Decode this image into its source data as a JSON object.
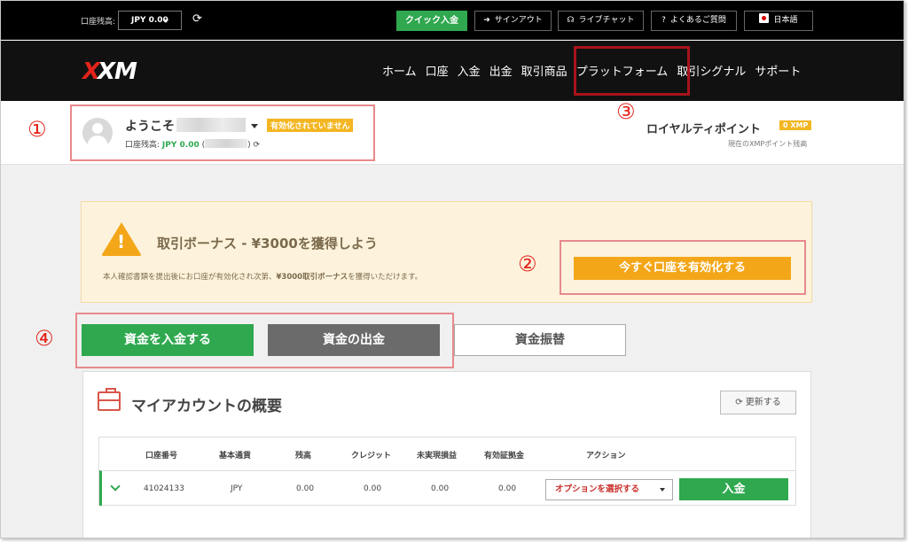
{
  "topbar": {
    "balance_label": "口座残高:",
    "balance_value": "JPY 0.00",
    "quick_deposit": "クイック入金",
    "signout": "サインアウト",
    "live_chat": "ライブチャット",
    "faq": "よくあるご質問",
    "language": "日本語"
  },
  "nav": {
    "items": [
      "ホーム",
      "口座",
      "入金",
      "出金",
      "取引商品",
      "プラットフォーム",
      "取引シグナル",
      "サポート"
    ]
  },
  "annotations": [
    "①",
    "②",
    "③",
    "④"
  ],
  "profile": {
    "welcome": "ようこそ",
    "status_badge": "有効化されていません",
    "balance_label": "口座残高:",
    "balance_value": "JPY 0.00",
    "paren_open": "(",
    "paren_close": ")",
    "loyalty_title": "ロイヤルティポイント",
    "loyalty_badge": "0 XMP",
    "loyalty_sub": "現在のXMPポイント残高"
  },
  "bonus": {
    "title": "取引ボーナス - ¥3000を獲得しよう",
    "text_pre": "本人確認書類を提出後にお口座が有効化され次第、",
    "text_bold": "¥3000取引ボーナス",
    "text_post": "を獲得いただけます。",
    "activate_button": "今すぐ口座を有効化する"
  },
  "actions": {
    "deposit": "資金を入金する",
    "withdraw": "資金の出金",
    "transfer": "資金振替"
  },
  "overview": {
    "title": "マイアカウントの概要",
    "refresh": "更新する",
    "headers": [
      "口座番号",
      "基本通貨",
      "残高",
      "クレジット",
      "未実現損益",
      "有効証拠金",
      "アクション"
    ],
    "row": {
      "account_no": "41024133",
      "currency": "JPY",
      "balance": "0.00",
      "credit": "0.00",
      "unrealized": "0.00",
      "equity": "0.00",
      "option_select": "オプションを選択する",
      "deposit_button": "入金"
    }
  },
  "colors": {
    "green": "#2fa84f",
    "orange": "#f3a618",
    "highlight_pink": "#e8898b",
    "highlight_red": "#a8131b",
    "brand_red": "#e3231b"
  }
}
